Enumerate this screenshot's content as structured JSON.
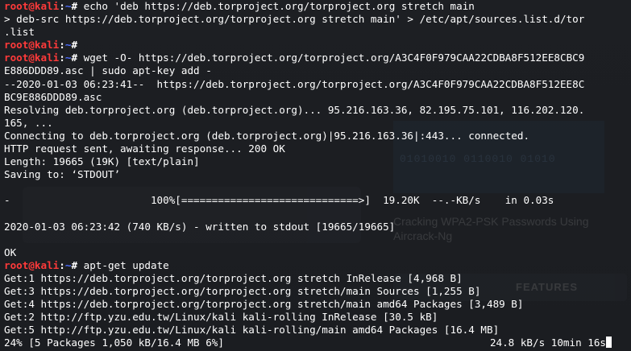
{
  "window": {
    "background": "#1b1d21",
    "prompt_user_color": "#ff3a3a",
    "prompt_path_color": "#4d6dff"
  },
  "prompt": {
    "user": "root@kali",
    "separator": ":",
    "path": "~",
    "symbol": "#"
  },
  "background_page": {
    "panel_text": "01010010 0110010 01010",
    "article_title": "Cracking WPA2-PSK Passwords Using Aircrack-Ng",
    "badge_text": "FEATURES"
  },
  "lines": [
    {
      "type": "prompt",
      "command": " echo 'deb https://deb.torproject.org/torproject.org stretch main"
    },
    {
      "type": "output",
      "text": "> deb-src https://deb.torproject.org/torproject.org stretch main' > /etc/apt/sources.list.d/tor"
    },
    {
      "type": "output",
      "text": ".list"
    },
    {
      "type": "prompt",
      "command": ""
    },
    {
      "type": "prompt",
      "command": " wget -O- https://deb.torproject.org/torproject.org/A3C4F0F979CAA22CDBA8F512EE8CBC9"
    },
    {
      "type": "output",
      "text": "E886DDD89.asc | sudo apt-key add -"
    },
    {
      "type": "output",
      "text": "--2020-01-03 06:23:41--  https://deb.torproject.org/torproject.org/A3C4F0F979CAA22CDBA8F512EE8C"
    },
    {
      "type": "output",
      "text": "BC9E886DDD89.asc"
    },
    {
      "type": "output",
      "text": "Resolving deb.torproject.org (deb.torproject.org)... 95.216.163.36, 82.195.75.101, 116.202.120."
    },
    {
      "type": "output",
      "text": "165, ..."
    },
    {
      "type": "output",
      "text": "Connecting to deb.torproject.org (deb.torproject.org)|95.216.163.36|:443... connected."
    },
    {
      "type": "output",
      "text": "HTTP request sent, awaiting response... 200 OK"
    },
    {
      "type": "output",
      "text": "Length: 19665 (19K) [text/plain]"
    },
    {
      "type": "output",
      "text": "Saving to: ‘STDOUT’"
    },
    {
      "type": "output",
      "text": ""
    },
    {
      "type": "output",
      "text": "-                       100%[=============================>]  19.20K  --.-KB/s    in 0.03s"
    },
    {
      "type": "output",
      "text": ""
    },
    {
      "type": "output",
      "text": "2020-01-03 06:23:42 (740 KB/s) - written to stdout [19665/19665]"
    },
    {
      "type": "output",
      "text": ""
    },
    {
      "type": "output",
      "text": "OK"
    },
    {
      "type": "prompt",
      "command": " apt-get update"
    },
    {
      "type": "output",
      "text": "Get:1 https://deb.torproject.org/torproject.org stretch InRelease [4,968 B]"
    },
    {
      "type": "output",
      "text": "Get:3 https://deb.torproject.org/torproject.org stretch/main Sources [1,255 B]"
    },
    {
      "type": "output",
      "text": "Get:4 https://deb.torproject.org/torproject.org stretch/main amd64 Packages [3,489 B]"
    },
    {
      "type": "output",
      "text": "Get:2 http://ftp.yzu.edu.tw/Linux/kali kali-rolling InRelease [30.5 kB]"
    },
    {
      "type": "output",
      "text": "Get:5 http://ftp.yzu.edu.tw/Linux/kali kali-rolling/main amd64 Packages [16.4 MB]"
    }
  ],
  "status_line": {
    "left": "24% [5 Packages 1,050 kB/16.4 MB 6%]",
    "right": "24.8 kB/s 10min 16s",
    "progress_percent": 24
  }
}
